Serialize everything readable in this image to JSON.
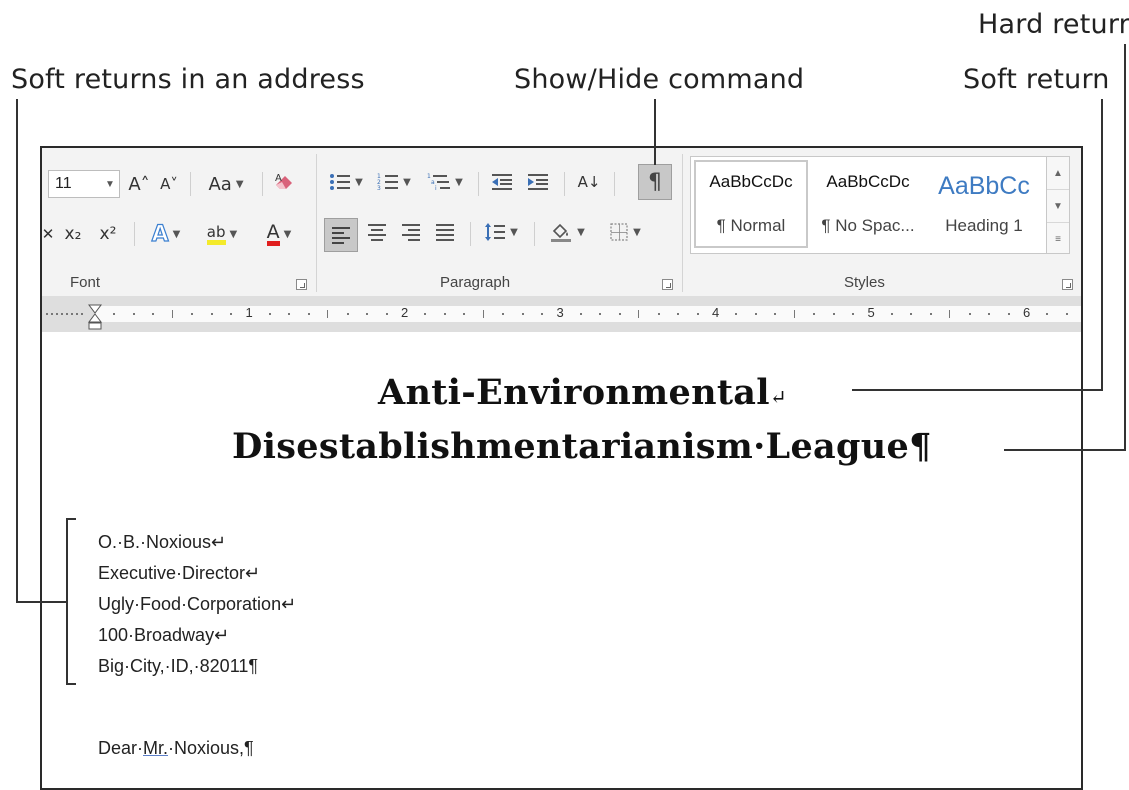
{
  "callouts": {
    "hard_return": "Hard return",
    "soft_returns_address": "Soft returns in an address",
    "show_hide_command": "Show/Hide command",
    "soft_return": "Soft return"
  },
  "ribbon": {
    "font": {
      "size_value": "11",
      "grow_icon": "A˄",
      "shrink_icon": "A˅",
      "change_case": "Aa",
      "subscript": "x₂",
      "superscript": "x²",
      "text_effects": "A",
      "highlight": "ab",
      "font_color": "A",
      "group_label": "Font"
    },
    "paragraph": {
      "show_hide_glyph": "¶",
      "sort_glyph": "A↓",
      "group_label": "Paragraph"
    },
    "styles": {
      "items": [
        {
          "sample": "AaBbCcDc",
          "name": "¶ Normal"
        },
        {
          "sample": "AaBbCcDc",
          "name": "¶ No Spac..."
        },
        {
          "sample": "AaBbCc",
          "name": "Heading 1"
        }
      ],
      "group_label": "Styles"
    }
  },
  "ruler": {
    "numbers": [
      "1",
      "2",
      "3",
      "4",
      "5",
      "6"
    ]
  },
  "document": {
    "title_line_1": "Anti-Environmental",
    "soft_return_mark": "↵",
    "title_line_2": "Disestablishmentarianism·League",
    "pilcrow": "¶",
    "address": [
      "O.·B.·Noxious↵",
      "Executive·Director↵",
      "Ugly·Food·Corporation↵",
      "100·Broadway↵",
      "Big·City,·ID,·82011¶"
    ],
    "salutation_pre": "Dear·",
    "salutation_underlined": "Mr.",
    "salutation_post": "·Noxious,¶"
  }
}
